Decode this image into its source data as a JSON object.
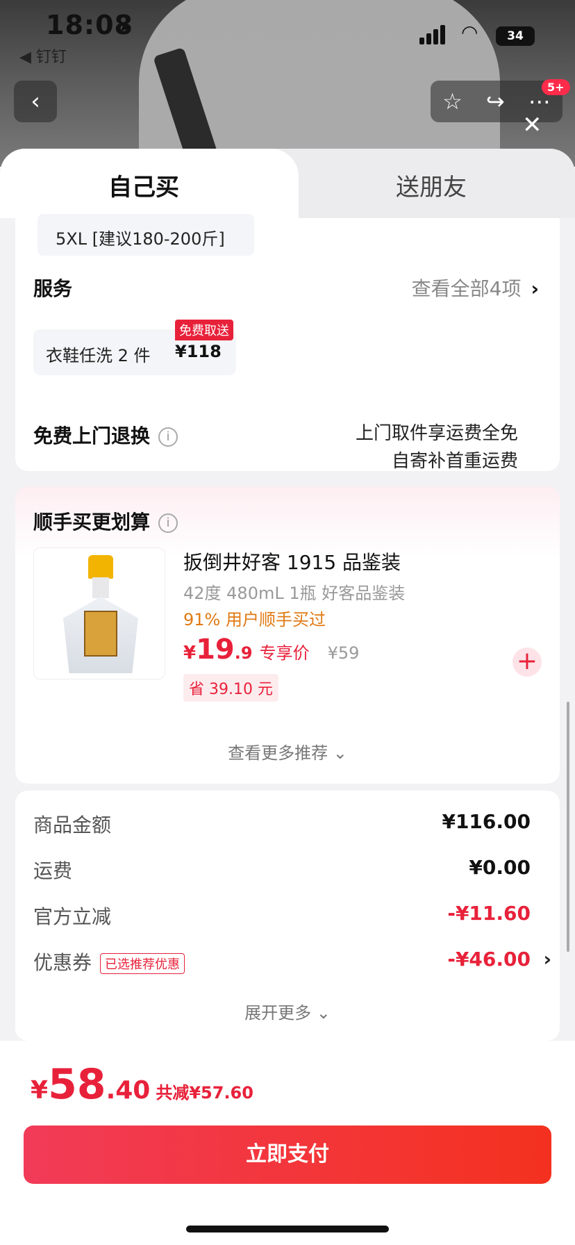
{
  "status_bar": {
    "time": "18:08",
    "back_app": "◀ 钉钉",
    "battery": "34"
  },
  "nav": {
    "badge": "5+"
  },
  "tabs": {
    "self": "自己买",
    "gift": "送朋友"
  },
  "spec": {
    "size": "5XL [建议180-200斤]"
  },
  "service": {
    "title": "服务",
    "view_all": "查看全部4项",
    "item_name": "衣鞋任洗 2 件",
    "item_price": "¥118",
    "item_tag": "免费取送"
  },
  "free_return": {
    "title": "免费上门退换",
    "line1": "上门取件享运费全免",
    "line2": "自寄补首重运费"
  },
  "recommend": {
    "title": "顺手买更划算",
    "product_name": "扳倒井好客 1915 品鉴装",
    "product_spec": "42度 480mL 1瓶 好客品鉴装",
    "bought": "91% 用户顺手买过",
    "price_symbol": "¥",
    "price_int": "19",
    "price_dec": ".9",
    "price_tag": "专享价",
    "price_orig": "¥59",
    "save": "省 39.10 元",
    "more": "查看更多推荐 ⌄"
  },
  "summary": {
    "rows": [
      {
        "label": "商品金额",
        "value": "¥116.00"
      },
      {
        "label": "运费",
        "value": "¥0.00"
      },
      {
        "label": "官方立减",
        "value": "-¥11.60"
      },
      {
        "label": "优惠券",
        "value": "-¥46.00"
      }
    ],
    "coupon_tag": "已选推荐优惠",
    "expand": "展开更多 ⌄"
  },
  "checkout": {
    "symbol": "¥",
    "total_int": "58",
    "total_dec": ".40",
    "reduced": "共减¥57.60",
    "pay_button": "立即支付"
  },
  "colors": {
    "accent": "#e8213a",
    "orange": "#e07a14"
  },
  "icons": [
    "location-arrow-icon",
    "signal-icon",
    "wifi-icon",
    "battery-icon",
    "back-icon",
    "star-icon",
    "share-icon",
    "more-icon",
    "close-icon",
    "info-icon",
    "chevron-right-icon",
    "plus-icon"
  ]
}
